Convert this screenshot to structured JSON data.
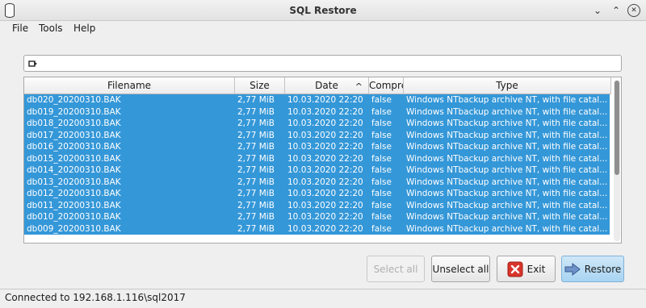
{
  "window": {
    "title": "SQL Restore"
  },
  "menu": {
    "items": [
      "File",
      "Tools",
      "Help"
    ]
  },
  "path": {
    "value": ""
  },
  "table": {
    "columns": [
      "Filename",
      "Size",
      "Date",
      "Compress",
      "Type"
    ],
    "sorted_column": "Date",
    "sort_direction": "ascending",
    "rows": [
      [
        "db020_20200310.BAK",
        "2,77 MiB",
        "10.03.2020 22:20",
        "false",
        "Windows NTbackup archive NT, with file catal..."
      ],
      [
        "db019_20200310.BAK",
        "2,77 MiB",
        "10.03.2020 22:20",
        "false",
        "Windows NTbackup archive NT, with file catal..."
      ],
      [
        "db018_20200310.BAK",
        "2,77 MiB",
        "10.03.2020 22:20",
        "false",
        "Windows NTbackup archive NT, with file catal..."
      ],
      [
        "db017_20200310.BAK",
        "2,77 MiB",
        "10.03.2020 22:20",
        "false",
        "Windows NTbackup archive NT, with file catal..."
      ],
      [
        "db016_20200310.BAK",
        "2,77 MiB",
        "10.03.2020 22:20",
        "false",
        "Windows NTbackup archive NT, with file catal..."
      ],
      [
        "db015_20200310.BAK",
        "2,77 MiB",
        "10.03.2020 22:20",
        "false",
        "Windows NTbackup archive NT, with file catal..."
      ],
      [
        "db014_20200310.BAK",
        "2,77 MiB",
        "10.03.2020 22:20",
        "false",
        "Windows NTbackup archive NT, with file catal..."
      ],
      [
        "db013_20200310.BAK",
        "2,77 MiB",
        "10.03.2020 22:20",
        "false",
        "Windows NTbackup archive NT, with file catal..."
      ],
      [
        "db012_20200310.BAK",
        "2,77 MiB",
        "10.03.2020 22:20",
        "false",
        "Windows NTbackup archive NT, with file catal..."
      ],
      [
        "db011_20200310.BAK",
        "2,77 MiB",
        "10.03.2020 22:20",
        "false",
        "Windows NTbackup archive NT, with file catal..."
      ],
      [
        "db010_20200310.BAK",
        "2,77 MiB",
        "10.03.2020 22:20",
        "false",
        "Windows NTbackup archive NT, with file catal..."
      ],
      [
        "db009_20200310.BAK",
        "2,77 MiB",
        "10.03.2020 22:20",
        "false",
        "Windows NTbackup archive NT, with file catal..."
      ]
    ],
    "all_rows_selected": true,
    "selection_color": "#3497d8"
  },
  "buttons": {
    "select_all": "Select all",
    "unselect_all": "Unselect all",
    "exit": "Exit",
    "restore": "Restore"
  },
  "status": {
    "text": "Connected to 192.168.1.116\\sql2017"
  },
  "icons": {
    "app": "database-icon",
    "path": "folder-arrow-icon",
    "exit": "red-x-icon",
    "restore": "restore-arrow-icon"
  }
}
